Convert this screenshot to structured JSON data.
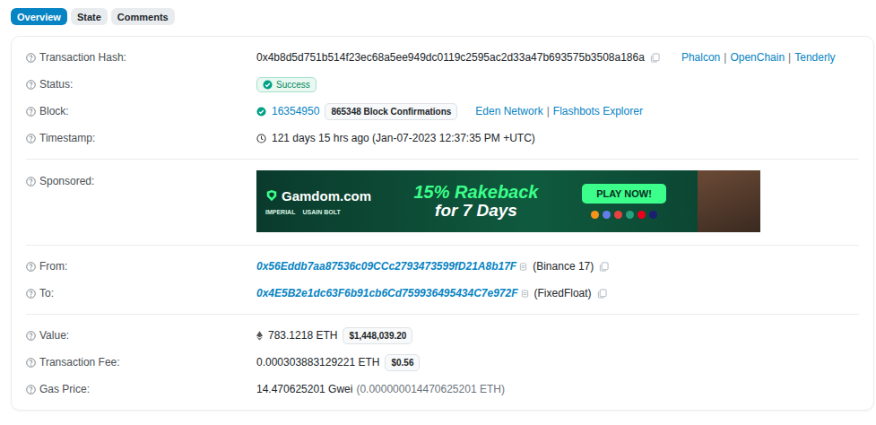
{
  "tabs": [
    {
      "label": "Overview",
      "selected": true
    },
    {
      "label": "State",
      "selected": false
    },
    {
      "label": "Comments",
      "selected": false
    }
  ],
  "separator": "|",
  "sections": [
    {
      "rows": [
        {
          "kind": "hash",
          "label": "Transaction Hash:",
          "value": "0x4b8d5d751b514f23ec68a5ee949dc0119c2595ac2d33a47b693575b3508a186a",
          "links": [
            "Phalcon",
            "OpenChain",
            "Tenderly"
          ]
        },
        {
          "kind": "status",
          "label": "Status:",
          "value": "Success"
        },
        {
          "kind": "block",
          "label": "Block:",
          "value": "16354950",
          "badge": "865348 Block Confirmations",
          "links": [
            "Eden Network",
            "Flashbots Explorer"
          ]
        },
        {
          "kind": "timestamp",
          "label": "Timestamp:",
          "value": "121 days 15 hrs ago (Jan-07-2023 12:37:35 PM +UTC)"
        }
      ]
    },
    {
      "rows": [
        {
          "kind": "sponsored",
          "label": "Sponsored:",
          "ad": {
            "brand": "Gamdom.com",
            "partners": [
              "IMPERIAL",
              "USAIN BOLT"
            ],
            "headline": "15% Rakeback",
            "subline": "for 7 Days",
            "button": "PLAY NOW!"
          }
        }
      ]
    },
    {
      "rows": [
        {
          "kind": "address",
          "label": "From:",
          "value": "0x56Eddb7aa87536c09CCc2793473599fD21A8b17F",
          "name": "(Binance 17)"
        },
        {
          "kind": "address",
          "label": "To:",
          "value": "0x4E5B2e1dc63F6b91cb6Cd759936495434C7e972F",
          "name": "(FixedFloat)"
        }
      ]
    },
    {
      "rows": [
        {
          "kind": "value",
          "label": "Value:",
          "value": "783.1218 ETH",
          "badge": "$1,448,039.20"
        },
        {
          "kind": "fee",
          "label": "Transaction Fee:",
          "value": "0.000303883129221 ETH",
          "badge": "$0.56"
        },
        {
          "kind": "gas",
          "label": "Gas Price:",
          "value": "14.470625201 Gwei",
          "detail": "(0.000000014470625201 ETH)"
        }
      ]
    }
  ]
}
